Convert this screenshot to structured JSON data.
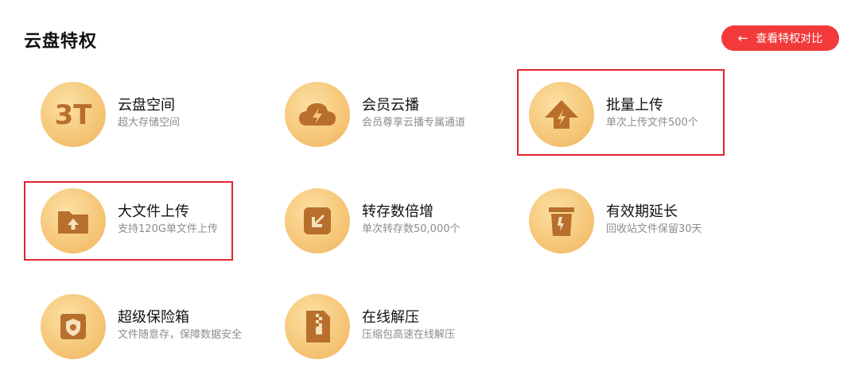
{
  "header": {
    "title": "云盘特权",
    "compare_label": "查看特权对比"
  },
  "features": [
    {
      "id": "space",
      "name": "云盘空间",
      "desc": "超大存储空间",
      "icon": "3t-storage-icon",
      "icon_text": "3T",
      "highlighted": false
    },
    {
      "id": "cloud-play",
      "name": "会员云播",
      "desc": "会员尊享云播专属通道",
      "icon": "cloud-lightning-icon",
      "highlighted": false
    },
    {
      "id": "batch-upload",
      "name": "批量上传",
      "desc": "单次上传文件500个",
      "icon": "upload-arrow-icon",
      "highlighted": true
    },
    {
      "id": "large-upload",
      "name": "大文件上传",
      "desc": "支持120G单文件上传",
      "icon": "folder-upload-icon",
      "highlighted": true
    },
    {
      "id": "transfer",
      "name": "转存数倍增",
      "desc": "单次转存数50,000个",
      "icon": "transfer-arrow-icon",
      "highlighted": false
    },
    {
      "id": "validity",
      "name": "有效期延长",
      "desc": "回收站文件保留30天",
      "icon": "recycle-bin-icon",
      "highlighted": false
    },
    {
      "id": "safe-box",
      "name": "超级保险箱",
      "desc": "文件随意存，保障数据安全",
      "icon": "safe-box-icon",
      "highlighted": false
    },
    {
      "id": "unzip",
      "name": "在线解压",
      "desc": "压缩包高速在线解压",
      "icon": "zip-file-icon",
      "highlighted": false
    }
  ],
  "colors": {
    "accent_red": "#f23a3a",
    "highlight_border": "#e1252d",
    "icon_gold": "#f6c87a",
    "icon_brown": "#b86f2c"
  }
}
